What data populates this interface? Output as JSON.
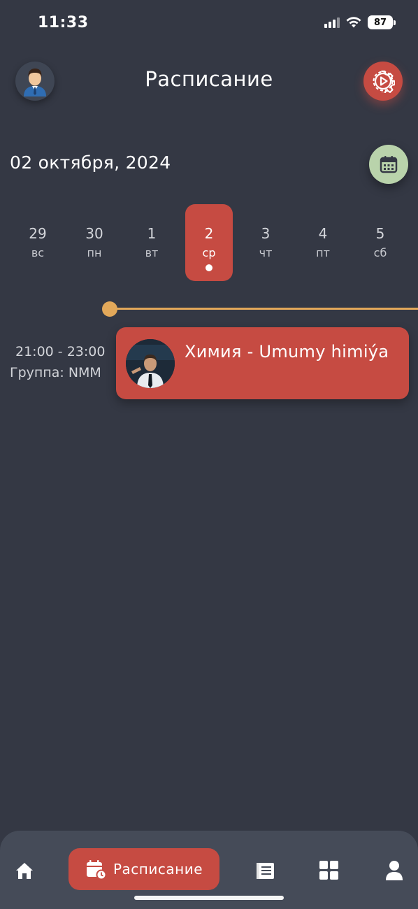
{
  "status_bar": {
    "time": "11:33",
    "battery": "87"
  },
  "header": {
    "title": "Расписание"
  },
  "current_date": "02 октября, 2024",
  "week": [
    {
      "num": "29",
      "name": "вс",
      "selected": false
    },
    {
      "num": "30",
      "name": "пн",
      "selected": false
    },
    {
      "num": "1",
      "name": "вт",
      "selected": false
    },
    {
      "num": "2",
      "name": "ср",
      "selected": true
    },
    {
      "num": "3",
      "name": "чт",
      "selected": false
    },
    {
      "num": "4",
      "name": "пт",
      "selected": false
    },
    {
      "num": "5",
      "name": "сб",
      "selected": false
    }
  ],
  "lessons": [
    {
      "time": "21:00 - 23:00",
      "group": "Группа: NMM",
      "title": "Химия - Umumy himiýa"
    }
  ],
  "bottom_nav": {
    "items": [
      "home-icon",
      "schedule-icon",
      "journal-icon",
      "grid-icon",
      "profile-icon"
    ],
    "active_label": "Расписание"
  },
  "colors": {
    "background": "#343844",
    "accent": "#c64b42",
    "calendar_button": "#b9d3ab",
    "timeline": "#e2a85a",
    "nav_background": "#454b58"
  }
}
